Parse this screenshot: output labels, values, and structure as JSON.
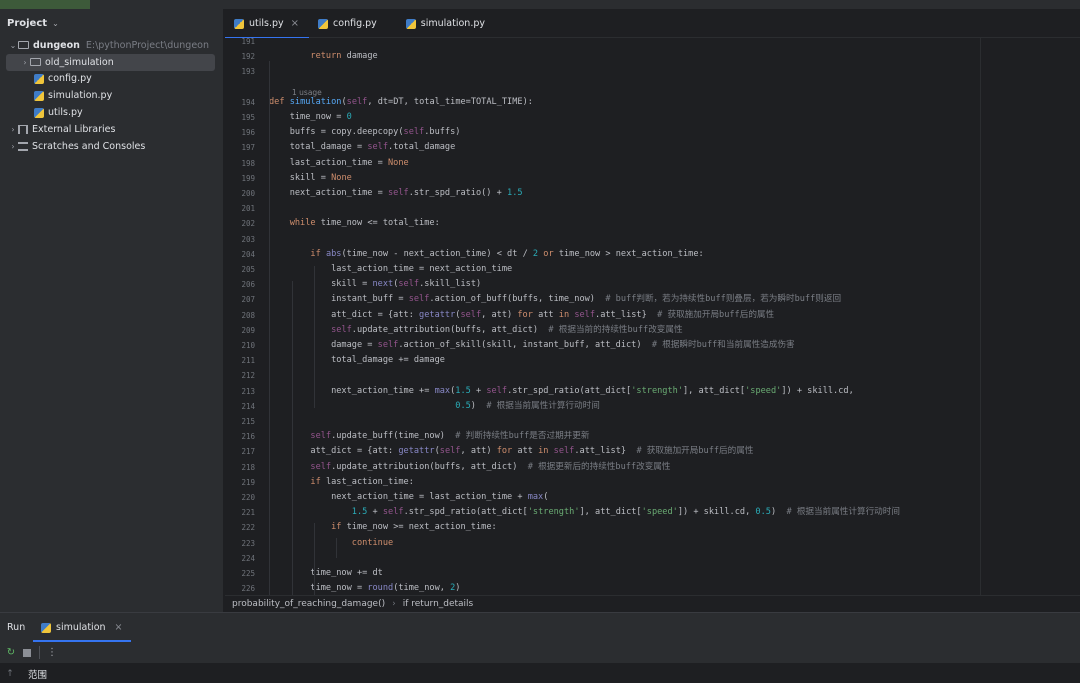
{
  "project": {
    "title": "Project",
    "root": {
      "name": "dungeon",
      "path": "E:\\pythonProject\\dungeon"
    },
    "items": [
      {
        "name": "old_simulation",
        "kind": "folder"
      },
      {
        "name": "config.py",
        "kind": "python"
      },
      {
        "name": "simulation.py",
        "kind": "python"
      },
      {
        "name": "utils.py",
        "kind": "python"
      }
    ],
    "external_libraries": "External Libraries",
    "scratches": "Scratches and Consoles"
  },
  "tabs": [
    {
      "label": "utils.py",
      "active": true
    },
    {
      "label": "config.py",
      "active": false
    },
    {
      "label": "simulation.py",
      "active": false
    }
  ],
  "editor": {
    "usage_hint": "1 usage",
    "lines": [
      {
        "n": "191",
        "t": ""
      },
      {
        "n": "192",
        "t": "        return damage"
      },
      {
        "n": "193",
        "t": ""
      },
      {
        "n": "194",
        "t": "def simulation(self, dt=DT, total_time=TOTAL_TIME):"
      },
      {
        "n": "195",
        "t": "    time_now = 0"
      },
      {
        "n": "196",
        "t": "    buffs = copy.deepcopy(self.buffs)"
      },
      {
        "n": "197",
        "t": "    total_damage = self.total_damage"
      },
      {
        "n": "198",
        "t": "    last_action_time = None"
      },
      {
        "n": "199",
        "t": "    skill = None"
      },
      {
        "n": "200",
        "t": "    next_action_time = self.str_spd_ratio() + 1.5"
      },
      {
        "n": "201",
        "t": ""
      },
      {
        "n": "202",
        "t": "    while time_now <= total_time:"
      },
      {
        "n": "203",
        "t": ""
      },
      {
        "n": "204",
        "t": "        if abs(time_now - next_action_time) < dt / 2 or time_now > next_action_time:"
      },
      {
        "n": "205",
        "t": "            last_action_time = next_action_time"
      },
      {
        "n": "206",
        "t": "            skill = next(self.skill_list)"
      },
      {
        "n": "207",
        "t": "            instant_buff = self.action_of_buff(buffs, time_now)  # buff判断，若为持续性buff则叠层，若为瞬时buff则返回"
      },
      {
        "n": "208",
        "t": "            att_dict = {att: getattr(self, att) for att in self.att_list}  # 获取施加开局buff后的属性"
      },
      {
        "n": "209",
        "t": "            self.update_attribution(buffs, att_dict)  # 根据当前的持续性buff改变属性"
      },
      {
        "n": "210",
        "t": "            damage = self.action_of_skill(skill, instant_buff, att_dict)  # 根据瞬时buff和当前属性造成伤害"
      },
      {
        "n": "211",
        "t": "            total_damage += damage"
      },
      {
        "n": "212",
        "t": ""
      },
      {
        "n": "213",
        "t": "            next_action_time += max(1.5 + self.str_spd_ratio(att_dict['strength'], att_dict['speed']) + skill.cd,"
      },
      {
        "n": "214",
        "t": "                                    0.5)  # 根据当前属性计算行动时间"
      },
      {
        "n": "215",
        "t": ""
      },
      {
        "n": "216",
        "t": "        self.update_buff(time_now)  # 判断持续性buff是否过期并更新"
      },
      {
        "n": "217",
        "t": "        att_dict = {att: getattr(self, att) for att in self.att_list}  # 获取施加开局buff后的属性"
      },
      {
        "n": "218",
        "t": "        self.update_attribution(buffs, att_dict)  # 根据更新后的持续性buff改变属性"
      },
      {
        "n": "219",
        "t": "        if last_action_time:"
      },
      {
        "n": "220",
        "t": "            next_action_time = last_action_time + max("
      },
      {
        "n": "221",
        "t": "                1.5 + self.str_spd_ratio(att_dict['strength'], att_dict['speed']) + skill.cd, 0.5)  # 根据当前属性计算行动时间"
      },
      {
        "n": "222",
        "t": "            if time_now >= next_action_time:"
      },
      {
        "n": "223",
        "t": "                continue"
      },
      {
        "n": "224",
        "t": ""
      },
      {
        "n": "225",
        "t": "        time_now += dt"
      },
      {
        "n": "226",
        "t": "        time_now = round(time_now, 2)"
      }
    ]
  },
  "breadcrumb": [
    "probability_of_reaching_damage()",
    "if return_details"
  ],
  "run": {
    "label": "Run",
    "tab": "simulation",
    "output": "范围"
  },
  "colors": {
    "keyword": "#cf8e6d",
    "function": "#56a8f5",
    "self": "#94558d",
    "number": "#2aacb8",
    "string": "#6aab73",
    "comment": "#7a7e85",
    "accent": "#3574f0"
  }
}
